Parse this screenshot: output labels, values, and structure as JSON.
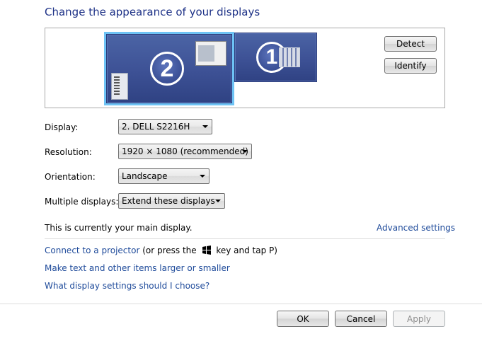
{
  "title": "Change the appearance of your displays",
  "preview": {
    "monitor2_number": "2",
    "monitor1_number": "1",
    "detect_label": "Detect",
    "identify_label": "Identify"
  },
  "settings": {
    "display_label": "Display:",
    "display_value": "2. DELL S2216H",
    "resolution_label": "Resolution:",
    "resolution_value": "1920 × 1080 (recommended)",
    "orientation_label": "Orientation:",
    "orientation_value": "Landscape",
    "multiple_label": "Multiple displays:",
    "multiple_value": "Extend these displays"
  },
  "status": {
    "main_display_text": "This is currently your main display.",
    "advanced_link": "Advanced settings"
  },
  "links": {
    "projector_link": "Connect to a projector",
    "projector_hint_before": "(or press the",
    "projector_hint_after": "key and tap P)",
    "text_size_link": "Make text and other items larger or smaller",
    "help_link": "What display settings should I choose?"
  },
  "footer": {
    "ok_label": "OK",
    "cancel_label": "Cancel",
    "apply_label": "Apply"
  }
}
